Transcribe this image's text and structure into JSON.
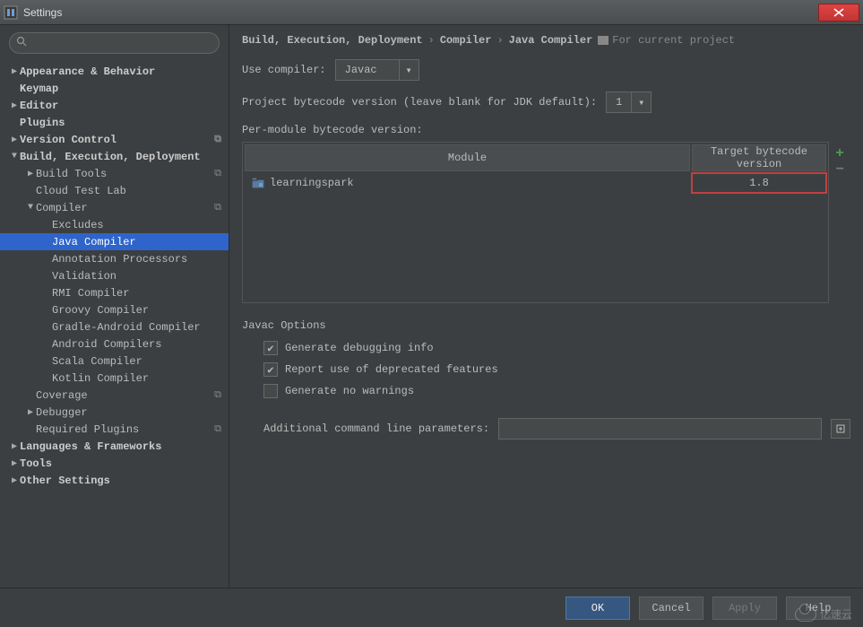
{
  "window": {
    "title": "Settings"
  },
  "search": {
    "placeholder": ""
  },
  "sidebar": {
    "items": [
      {
        "label": "Appearance & Behavior",
        "bold": true,
        "arrow": "▶",
        "indent": 0
      },
      {
        "label": "Keymap",
        "bold": true,
        "arrow": "",
        "indent": 0,
        "pad": true
      },
      {
        "label": "Editor",
        "bold": true,
        "arrow": "▶",
        "indent": 0
      },
      {
        "label": "Plugins",
        "bold": true,
        "arrow": "",
        "indent": 0,
        "pad": true
      },
      {
        "label": "Version Control",
        "bold": true,
        "arrow": "▶",
        "indent": 0,
        "badge": true
      },
      {
        "label": "Build, Execution, Deployment",
        "bold": true,
        "arrow": "▼",
        "indent": 0
      },
      {
        "label": "Build Tools",
        "arrow": "▶",
        "indent": 1,
        "badge": true
      },
      {
        "label": "Cloud Test Lab",
        "arrow": "",
        "indent": 1,
        "pad": true
      },
      {
        "label": "Compiler",
        "arrow": "▼",
        "indent": 1,
        "badge": true
      },
      {
        "label": "Excludes",
        "arrow": "",
        "indent": 2,
        "pad": true
      },
      {
        "label": "Java Compiler",
        "arrow": "",
        "indent": 2,
        "pad": true,
        "selected": true
      },
      {
        "label": "Annotation Processors",
        "arrow": "",
        "indent": 2,
        "pad": true
      },
      {
        "label": "Validation",
        "arrow": "",
        "indent": 2,
        "pad": true
      },
      {
        "label": "RMI Compiler",
        "arrow": "",
        "indent": 2,
        "pad": true
      },
      {
        "label": "Groovy Compiler",
        "arrow": "",
        "indent": 2,
        "pad": true
      },
      {
        "label": "Gradle-Android Compiler",
        "arrow": "",
        "indent": 2,
        "pad": true
      },
      {
        "label": "Android Compilers",
        "arrow": "",
        "indent": 2,
        "pad": true
      },
      {
        "label": "Scala Compiler",
        "arrow": "",
        "indent": 2,
        "pad": true
      },
      {
        "label": "Kotlin Compiler",
        "arrow": "",
        "indent": 2,
        "pad": true
      },
      {
        "label": "Coverage",
        "arrow": "",
        "indent": 1,
        "pad": true,
        "badge": true
      },
      {
        "label": "Debugger",
        "arrow": "▶",
        "indent": 1
      },
      {
        "label": "Required Plugins",
        "arrow": "",
        "indent": 1,
        "pad": true,
        "badge": true
      },
      {
        "label": "Languages & Frameworks",
        "bold": true,
        "arrow": "▶",
        "indent": 0
      },
      {
        "label": "Tools",
        "bold": true,
        "arrow": "▶",
        "indent": 0
      },
      {
        "label": "Other Settings",
        "bold": true,
        "arrow": "▶",
        "indent": 0
      }
    ]
  },
  "breadcrumb": {
    "parts": [
      "Build, Execution, Deployment",
      "Compiler",
      "Java Compiler"
    ],
    "sep": "›",
    "badge": "For current project"
  },
  "form": {
    "use_compiler_label": "Use compiler:",
    "use_compiler_value": "Javac",
    "project_bytecode_label": "Project bytecode version (leave blank for JDK default):",
    "project_bytecode_value": "1",
    "per_module_label": "Per-module bytecode version:",
    "table": {
      "headers": {
        "module": "Module",
        "target": "Target bytecode version"
      },
      "rows": [
        {
          "name": "learningspark",
          "target": "1.8"
        }
      ]
    },
    "javac_group": "Javac Options",
    "opt_debug": {
      "label": "Generate debugging info",
      "checked": true
    },
    "opt_deprecated": {
      "label": "Report use of deprecated features",
      "checked": true
    },
    "opt_nowarn": {
      "label": "Generate no warnings",
      "checked": false
    },
    "additional_label": "Additional command line parameters:",
    "additional_value": ""
  },
  "buttons": {
    "ok": "OK",
    "cancel": "Cancel",
    "apply": "Apply",
    "help": "Help"
  },
  "watermark": "亿速云"
}
